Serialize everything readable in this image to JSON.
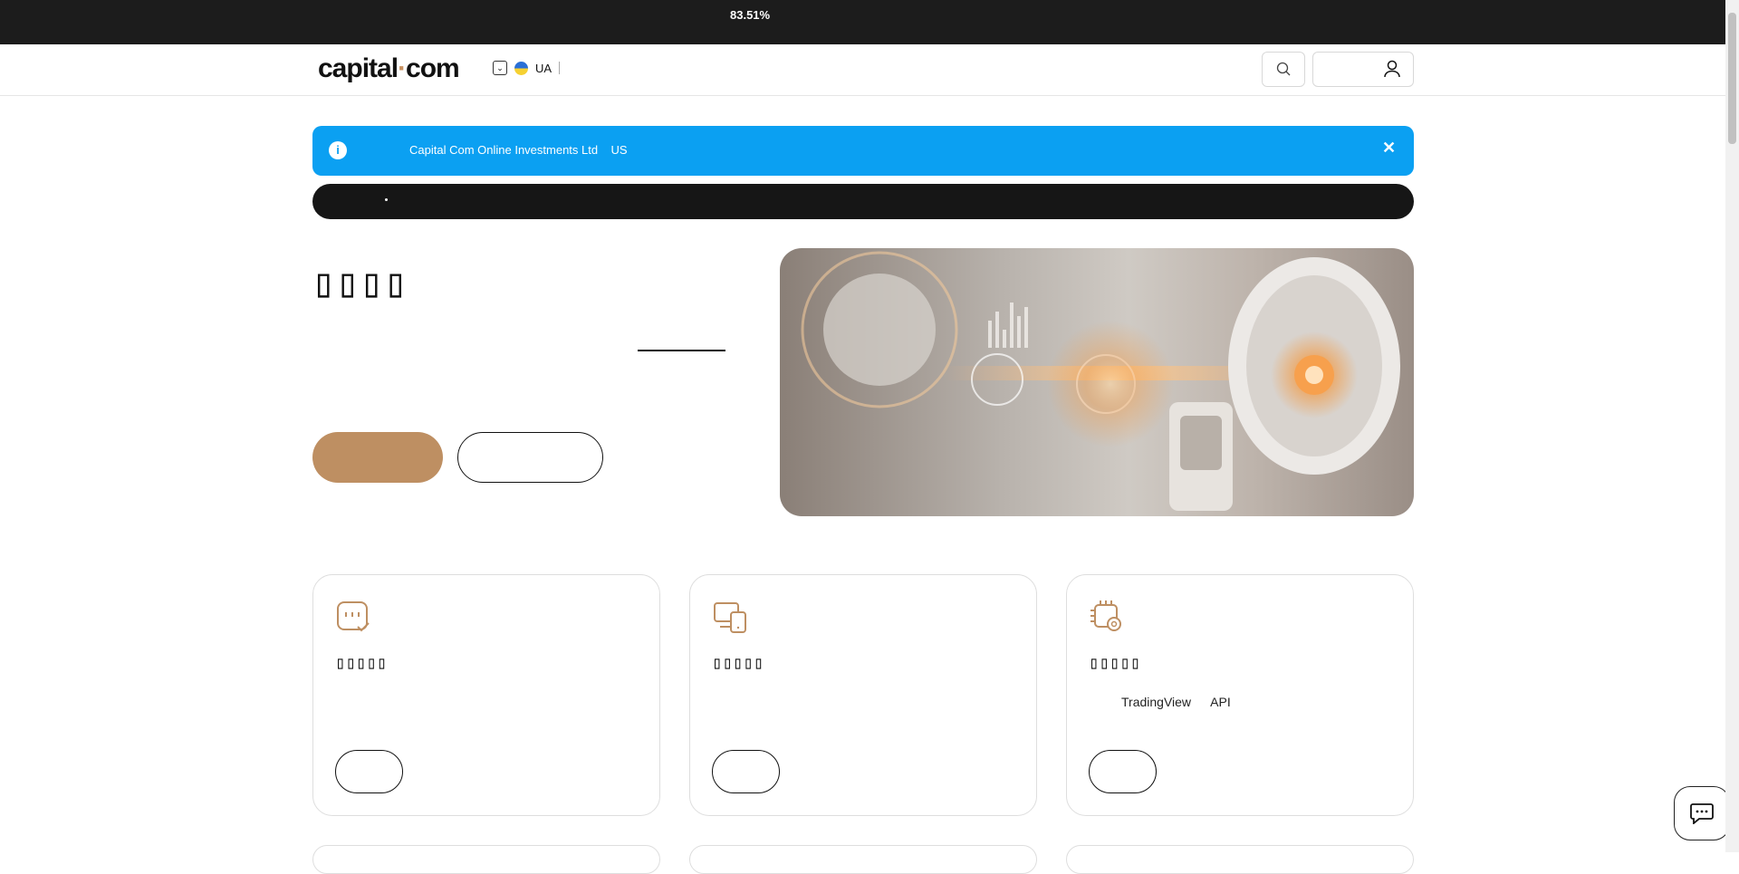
{
  "topbar": {
    "progress_text": "83.51%"
  },
  "header": {
    "logo_left": "capital",
    "logo_dot": "·",
    "logo_right": "com",
    "country_code": "UA",
    "icons": {
      "search": "search-icon",
      "account": "user-icon",
      "dropdown": "chevron-down-icon"
    }
  },
  "alert": {
    "text": "Capital Com Online Investments Ltd    US",
    "close": "✕",
    "info_icon": "i"
  },
  "hero": {
    "title": "▯▯▯▯"
  },
  "cards": [
    {
      "title": "▯▯▯▯▯",
      "desc": "",
      "icon": "message-check-icon"
    },
    {
      "title": "▯▯▯▯▯",
      "desc": "",
      "icon": "devices-icon"
    },
    {
      "title": "▯▯▯▯▯",
      "desc": "TradingView API",
      "icon": "chip-gear-icon"
    }
  ],
  "colors": {
    "accent": "#be8f62",
    "alert_bg": "#0ba0f2",
    "dark": "#161616"
  }
}
